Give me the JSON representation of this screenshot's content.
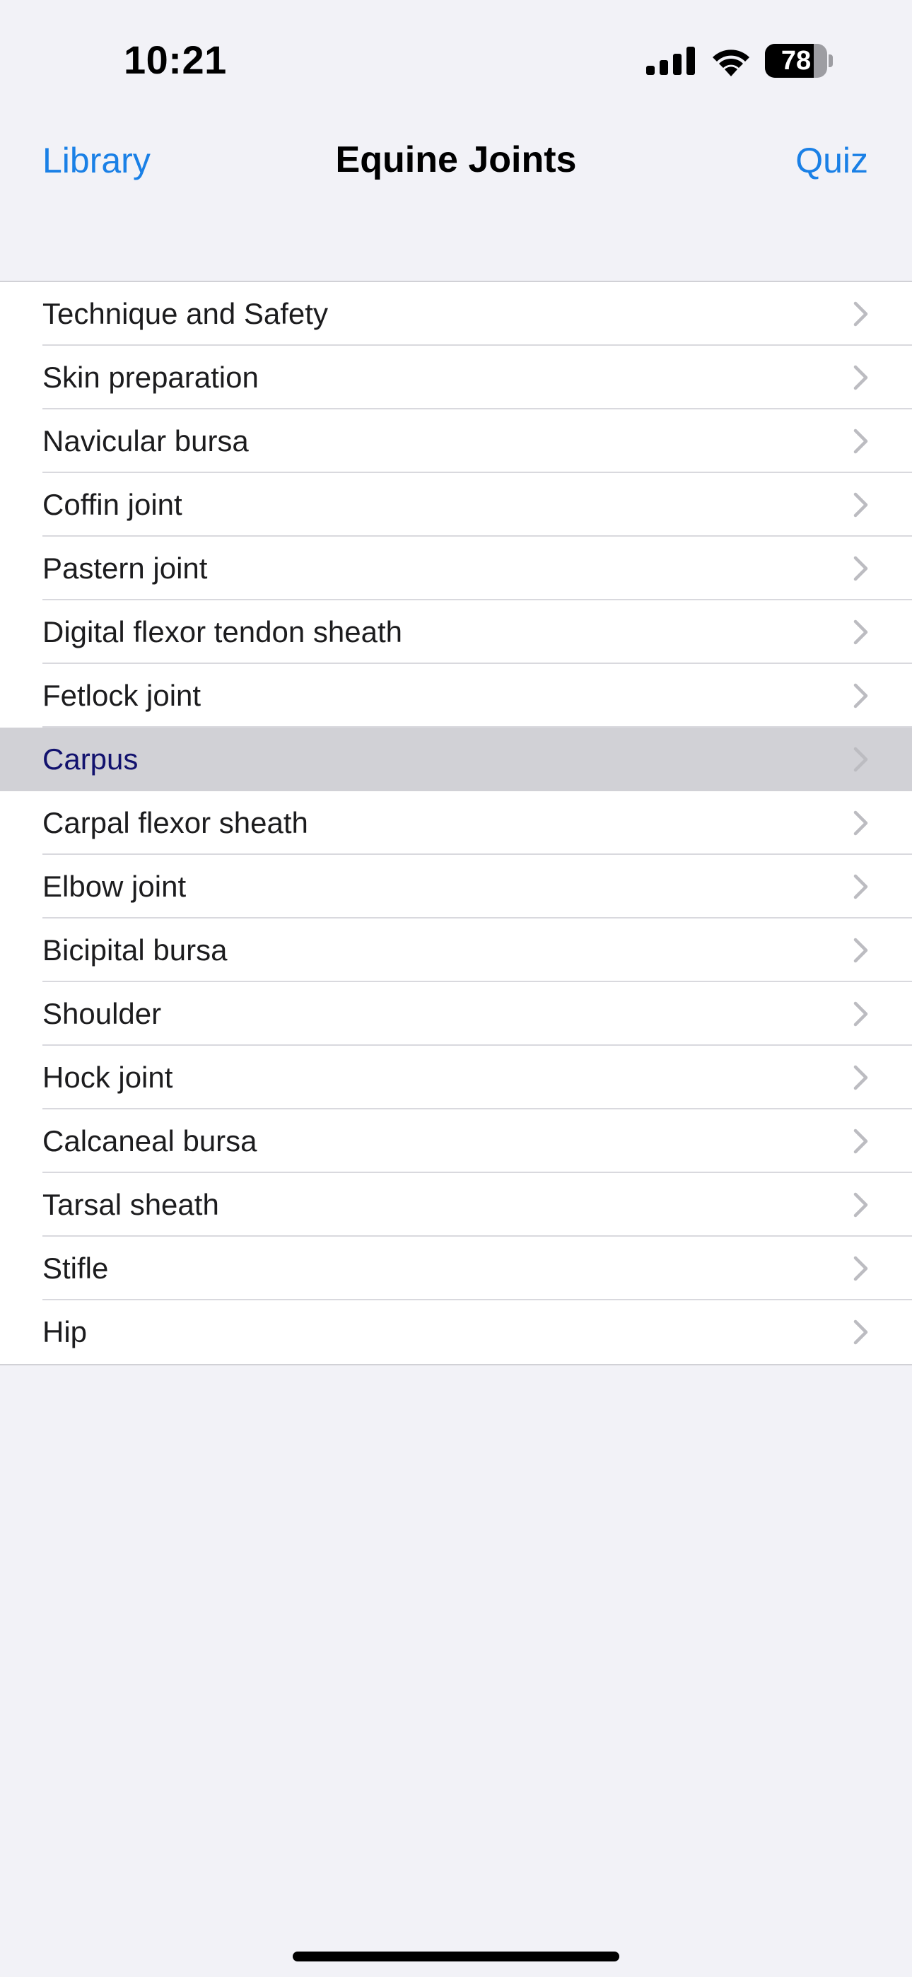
{
  "status_bar": {
    "time": "10:21",
    "battery_level": "78",
    "battery_fraction": 0.78
  },
  "nav": {
    "back_label": "Library",
    "title": "Equine Joints",
    "action_label": "Quiz"
  },
  "colors": {
    "accent": "#1a80e6",
    "selected_background": "#d1d1d6",
    "selected_text": "#12126e",
    "background": "#f2f2f7"
  },
  "icons": {
    "row_accessory": "chevron-right-icon",
    "signal": "cellular-signal-icon",
    "wifi": "wifi-icon",
    "battery": "battery-icon"
  },
  "list": {
    "items": [
      {
        "label": "Technique and Safety",
        "selected": false
      },
      {
        "label": "Skin preparation",
        "selected": false
      },
      {
        "label": "Navicular bursa",
        "selected": false
      },
      {
        "label": "Coffin joint",
        "selected": false
      },
      {
        "label": "Pastern joint",
        "selected": false
      },
      {
        "label": "Digital flexor tendon sheath",
        "selected": false
      },
      {
        "label": "Fetlock joint",
        "selected": false
      },
      {
        "label": "Carpus",
        "selected": true
      },
      {
        "label": "Carpal flexor sheath",
        "selected": false
      },
      {
        "label": "Elbow joint",
        "selected": false
      },
      {
        "label": "Bicipital bursa",
        "selected": false
      },
      {
        "label": "Shoulder",
        "selected": false
      },
      {
        "label": "Hock joint",
        "selected": false
      },
      {
        "label": "Calcaneal bursa",
        "selected": false
      },
      {
        "label": "Tarsal sheath",
        "selected": false
      },
      {
        "label": "Stifle",
        "selected": false
      },
      {
        "label": "Hip",
        "selected": false
      }
    ]
  }
}
